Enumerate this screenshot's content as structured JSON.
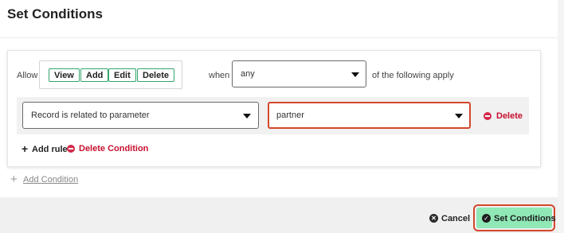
{
  "header": {
    "title": "Set Conditions"
  },
  "condition": {
    "allow_label": "Allow",
    "permissions": [
      "View",
      "Add",
      "Edit",
      "Delete"
    ],
    "when_label": "when",
    "match_select": "any",
    "following_label": "of the following apply",
    "rule": {
      "field_select": "Record is related to parameter",
      "value_select": "partner",
      "delete_label": "Delete"
    },
    "add_rule_label": "Add rule",
    "delete_condition_label": "Delete Condition"
  },
  "add_condition_label": "Add Condition",
  "footer": {
    "cancel_label": "Cancel",
    "submit_label": "Set Conditions"
  },
  "colors": {
    "accent_green": "#8fe8b6",
    "danger_red": "#c8102e",
    "highlight": "#d4472b",
    "chip_border": "#34a56b"
  },
  "icons": {
    "delete": "minus-circle-icon",
    "cancel": "x-circle-icon",
    "submit": "check-circle-icon",
    "add": "plus-icon",
    "dropdown": "caret-down-icon"
  }
}
